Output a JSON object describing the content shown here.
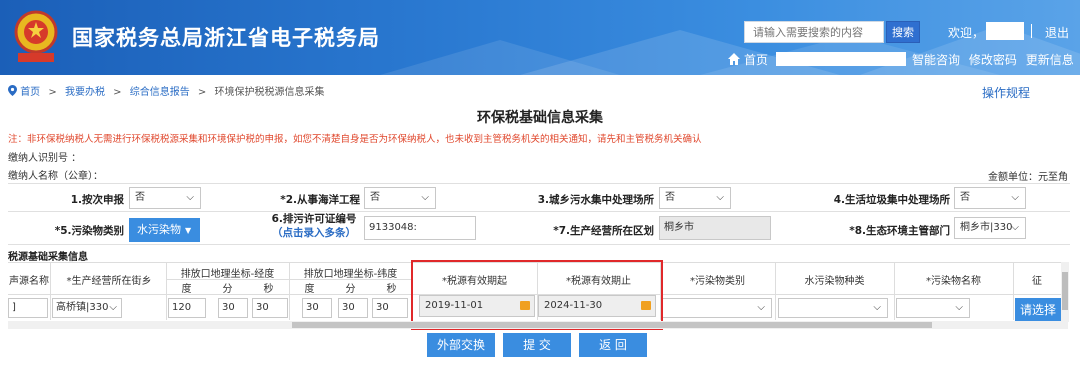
{
  "header": {
    "title": "国家税务总局浙江省电子税务局",
    "search_placeholder": "请输入需要搜索的内容",
    "search_button": "搜索",
    "welcome": "欢迎，",
    "logout": "退出",
    "home": "首页",
    "nav": [
      "智能咨询",
      "修改密码",
      "更新信息"
    ]
  },
  "breadcrumb": [
    "首页",
    "我要办税",
    "综合信息报告",
    "环境保护税税源信息采集"
  ],
  "breadcrumb_sep": ">",
  "op_guide": "操作规程",
  "page_title": "环保税基础信息采集",
  "notice": "注：非环保税纳税人无需进行环保税税源采集和环境保护税的申报，如您不清楚自身是否为环保纳税人，也未收到主管税务机关的相关通知，请先和主管税务机关确认",
  "taxpayer_id_label": "缴纳人识别号 ：",
  "taxpayer_name_label": "缴纳人名称（公章）：",
  "unit": "金额单位：元至角",
  "form": {
    "f1_label": "1.按次申报",
    "f1_value": "否",
    "f2_label": "*2.从事海洋工程",
    "f2_value": "否",
    "f3_label": "3.城乡污水集中处理场所",
    "f3_value": "否",
    "f4_label": "4.生活垃圾集中处理场所",
    "f4_value": "否",
    "f5_label": "*5.污染物类别",
    "f5_value": "水污染物",
    "f6_label_line1": "6.排污许可证编号",
    "f6_label_line2": "（点击录入多条）",
    "f6_value": "9133048:",
    "f7_label": "*7.生产经营所在区划",
    "f7_value": "桐乡市",
    "f8_label": "*8.生态环境主管部门",
    "f8_value": "桐乡市|330"
  },
  "table": {
    "section_title": "税源基础采集信息",
    "headers": {
      "source_name": "声源名称",
      "street": "*生产经营所在街乡",
      "longitude": "排放口地理坐标-经度",
      "latitude": "排放口地理坐标-纬度",
      "deg": "度",
      "min": "分",
      "sec": "秒",
      "valid_from": "*税源有效期起",
      "valid_to": "*税源有效期止",
      "pollutant_type": "*污染物类别",
      "water_type": "水污染物种类",
      "pollutant_name": "*污染物名称",
      "more": "征"
    },
    "row": {
      "source_name": "]",
      "street": "高桥镇|330",
      "lon_deg": "120",
      "lon_min": "30",
      "lon_sec": "30",
      "lat_deg": "30",
      "lat_min": "30",
      "lat_sec": "30",
      "valid_from": "2019-11-01",
      "valid_to": "2024-11-30",
      "pollutant_type": "",
      "water_type": "",
      "pollutant_name": "",
      "pick": "请选择"
    }
  },
  "buttons": {
    "exchange": "外部交换",
    "submit": "提 交",
    "back": "返 回"
  },
  "colors": {
    "header_blue": "#2a79d1",
    "button_blue": "#3a8de0",
    "link_blue": "#2a6cc4",
    "notice_red": "#e0482e",
    "highlight_red": "#e0282a",
    "calendar_orange": "#f0a020"
  }
}
